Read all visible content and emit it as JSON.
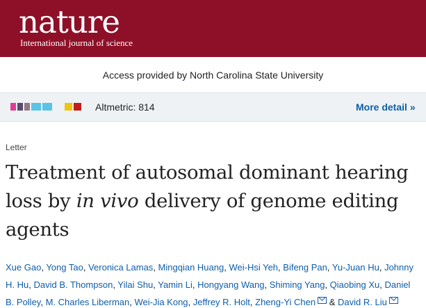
{
  "header": {
    "logo": "nature",
    "tagline": "International journal of science",
    "brand_color": "#8e1028"
  },
  "access_text": "Access provided by North Carolina State University",
  "altmetric": {
    "score_label": "Altmetric: 814",
    "more_detail_label": "More detail",
    "more_detail_icon": "double-chevron-right-icon",
    "segment_colors": [
      "#e03d92",
      "#5a4a6e",
      "#8f7a86",
      "#5bc3e5",
      "#5bc3e5",
      "#f1c40f",
      "#c51d1d"
    ]
  },
  "article": {
    "type": "Letter",
    "title_part1": "Treatment of autosomal dominant hearing loss by ",
    "title_italic": "in vivo",
    "title_part2": " delivery of genome editing agents"
  },
  "authors": [
    {
      "name": "Xue Gao",
      "sep": ", "
    },
    {
      "name": "Yong Tao",
      "sep": ", "
    },
    {
      "name": "Veronica Lamas",
      "sep": ", "
    },
    {
      "name": "Mingqian Huang",
      "sep": ", "
    },
    {
      "name": "Wei-Hsi Yeh",
      "sep": ", "
    },
    {
      "name": "Bifeng Pan",
      "sep": ", "
    },
    {
      "name": "Yu-Juan Hu",
      "sep": ", "
    },
    {
      "name": "Johnny H. Hu",
      "sep": ", "
    },
    {
      "name": "David B. Thompson",
      "sep": ", "
    },
    {
      "name": "Yilai Shu",
      "sep": ", "
    },
    {
      "name": "Yamin Li",
      "sep": ", "
    },
    {
      "name": "Hongyang Wang",
      "sep": ", "
    },
    {
      "name": "Shiming Yang",
      "sep": ", "
    },
    {
      "name": "Qiaobing Xu",
      "sep": ", "
    },
    {
      "name": "Daniel B. Polley",
      "sep": ", "
    },
    {
      "name": "M. Charles Liberman",
      "sep": ", "
    },
    {
      "name": "Wei-Jia Kong",
      "sep": ", "
    },
    {
      "name": "Jeffrey R. Holt",
      "sep": ", "
    },
    {
      "name": "Zheng-Yi Chen",
      "sep": " & ",
      "mail_icon": "mail-icon"
    },
    {
      "name": "David R. Liu",
      "sep": "",
      "mail_icon": "mail-icon"
    }
  ]
}
